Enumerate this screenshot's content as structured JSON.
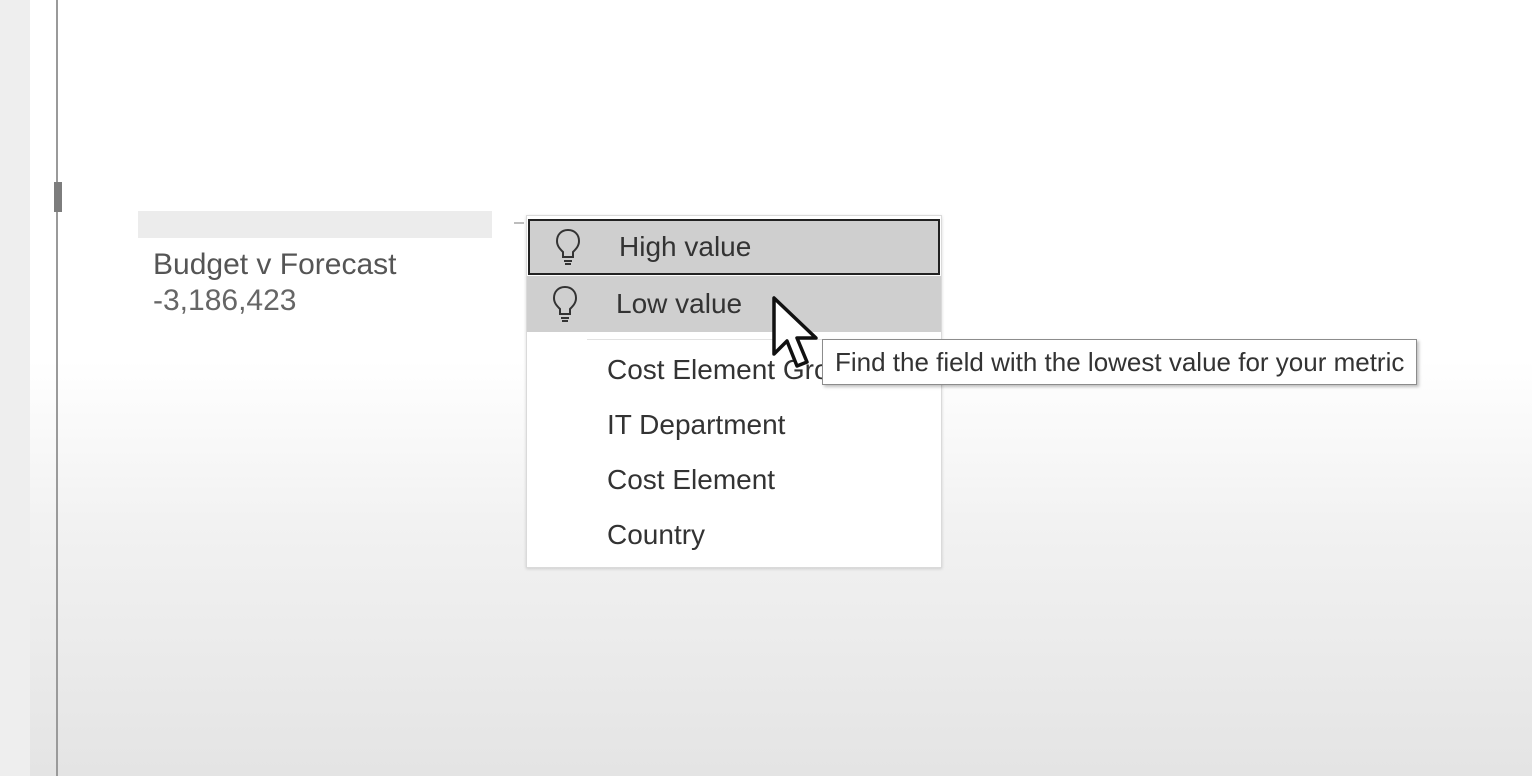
{
  "metric_card": {
    "title": "Budget v Forecast",
    "value": "-3,186,423"
  },
  "analyze_menu": {
    "insight_items": [
      {
        "label": "High value",
        "icon": "lightbulb-icon",
        "selected": true
      },
      {
        "label": "Low value",
        "icon": "lightbulb-icon",
        "hovered": true
      }
    ],
    "field_items": [
      {
        "label": "Cost Element Gro"
      },
      {
        "label": "IT Department"
      },
      {
        "label": "Cost Element"
      },
      {
        "label": "Country"
      }
    ]
  },
  "tooltip": {
    "text": "Find the field with the lowest value for your metric"
  },
  "colors": {
    "menu_highlight": "#cfcfcf",
    "selected_border": "#222222",
    "text": "#333333"
  }
}
